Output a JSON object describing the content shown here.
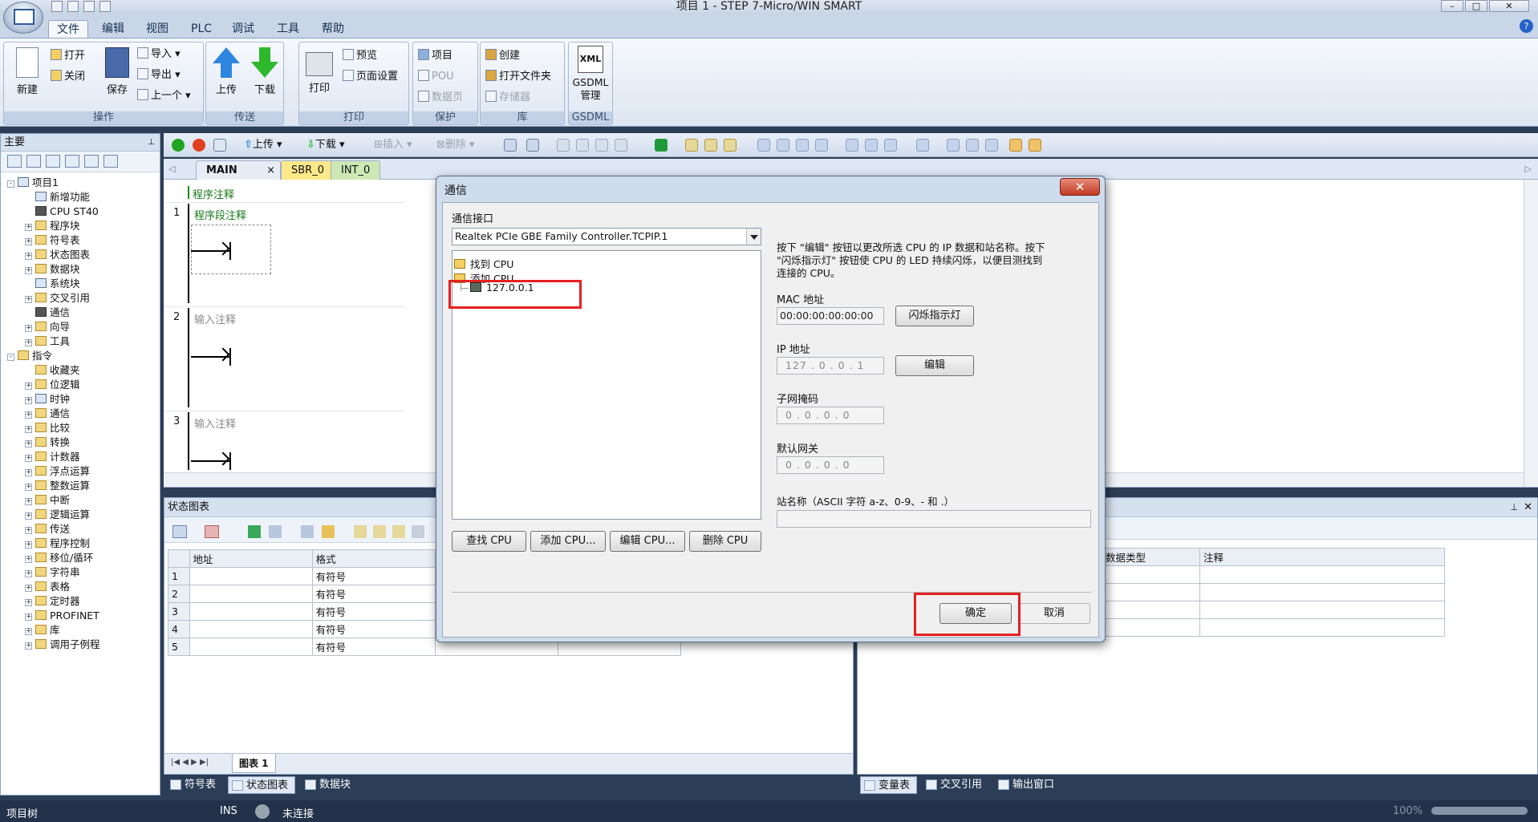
{
  "window": {
    "title": "项目 1 - STEP 7-Micro/WIN SMART"
  },
  "ribbon": {
    "tabs": [
      "文件",
      "编辑",
      "视图",
      "PLC",
      "调试",
      "工具",
      "帮助"
    ],
    "active_tab": "文件",
    "groups": {
      "operate": {
        "label": "操作",
        "new": "新建",
        "open": "打开",
        "close": "关闭",
        "save": "保存",
        "import": "导入",
        "export": "导出",
        "previous": "上一个"
      },
      "transfer": {
        "label": "传送",
        "upload": "上传",
        "download": "下载"
      },
      "print": {
        "label": "打印",
        "print": "打印",
        "preview": "预览",
        "page_setup": "页面设置"
      },
      "protect": {
        "label": "保护",
        "project": "项目",
        "pou": "POU",
        "data_page": "数据页"
      },
      "library": {
        "label": "库",
        "create": "创建",
        "open_folder": "打开文件夹",
        "memory": "存储器"
      },
      "gsdml": {
        "label": "GSDML",
        "xml": "XML",
        "manage_line1": "GSDML",
        "manage_line2": "管理"
      }
    },
    "help_icon": "?"
  },
  "left_panel": {
    "title": "主要",
    "pin": "📌",
    "tree": [
      {
        "label": "项目1",
        "level": 0,
        "expander": "-",
        "icon": "blue"
      },
      {
        "label": "新增功能",
        "level": 1,
        "expander": "",
        "icon": "blue"
      },
      {
        "label": "CPU ST40",
        "level": 1,
        "expander": "",
        "icon": "dark"
      },
      {
        "label": "程序块",
        "level": 1,
        "expander": "+",
        "icon": "folder"
      },
      {
        "label": "符号表",
        "level": 1,
        "expander": "+",
        "icon": "folder"
      },
      {
        "label": "状态图表",
        "level": 1,
        "expander": "+",
        "icon": "folder"
      },
      {
        "label": "数据块",
        "level": 1,
        "expander": "+",
        "icon": "folder"
      },
      {
        "label": "系统块",
        "level": 1,
        "expander": "",
        "icon": "blue"
      },
      {
        "label": "交叉引用",
        "level": 1,
        "expander": "+",
        "icon": "folder"
      },
      {
        "label": "通信",
        "level": 1,
        "expander": "",
        "icon": "dark"
      },
      {
        "label": "向导",
        "level": 1,
        "expander": "+",
        "icon": "folder"
      },
      {
        "label": "工具",
        "level": 1,
        "expander": "+",
        "icon": "folder"
      },
      {
        "label": "指令",
        "level": 0,
        "expander": "-",
        "icon": "folder"
      },
      {
        "label": "收藏夹",
        "level": 1,
        "expander": "",
        "icon": "folder"
      },
      {
        "label": "位逻辑",
        "level": 1,
        "expander": "+",
        "icon": "folder"
      },
      {
        "label": "时钟",
        "level": 1,
        "expander": "+",
        "icon": "blue"
      },
      {
        "label": "通信",
        "level": 1,
        "expander": "+",
        "icon": "folder"
      },
      {
        "label": "比较",
        "level": 1,
        "expander": "+",
        "icon": "folder"
      },
      {
        "label": "转换",
        "level": 1,
        "expander": "+",
        "icon": "folder"
      },
      {
        "label": "计数器",
        "level": 1,
        "expander": "+",
        "icon": "folder"
      },
      {
        "label": "浮点运算",
        "level": 1,
        "expander": "+",
        "icon": "folder"
      },
      {
        "label": "整数运算",
        "level": 1,
        "expander": "+",
        "icon": "folder"
      },
      {
        "label": "中断",
        "level": 1,
        "expander": "+",
        "icon": "folder"
      },
      {
        "label": "逻辑运算",
        "level": 1,
        "expander": "+",
        "icon": "folder"
      },
      {
        "label": "传送",
        "level": 1,
        "expander": "+",
        "icon": "folder"
      },
      {
        "label": "程序控制",
        "level": 1,
        "expander": "+",
        "icon": "folder"
      },
      {
        "label": "移位/循环",
        "level": 1,
        "expander": "+",
        "icon": "folder"
      },
      {
        "label": "字符串",
        "level": 1,
        "expander": "+",
        "icon": "folder"
      },
      {
        "label": "表格",
        "level": 1,
        "expander": "+",
        "icon": "folder"
      },
      {
        "label": "定时器",
        "level": 1,
        "expander": "+",
        "icon": "folder"
      },
      {
        "label": "PROFINET",
        "level": 1,
        "expander": "+",
        "icon": "folder"
      },
      {
        "label": "库",
        "level": 1,
        "expander": "+",
        "icon": "folder"
      },
      {
        "label": "调用子例程",
        "level": 1,
        "expander": "+",
        "icon": "folder"
      }
    ]
  },
  "toolbar": {
    "upload": "上传",
    "download": "下载",
    "insert": "插入",
    "delete": "删除"
  },
  "editor": {
    "tabs": [
      {
        "label": "MAIN",
        "close": "×",
        "color": "#e8edf5"
      },
      {
        "label": "SBR_0",
        "color": "#fde98a"
      },
      {
        "label": "INT_0",
        "color": "#cde8b4"
      }
    ],
    "program_comment": "程序注释",
    "networks": [
      {
        "num": "1",
        "comment": "程序段注释"
      },
      {
        "num": "2",
        "comment": "输入注释"
      },
      {
        "num": "3",
        "comment": "输入注释"
      }
    ]
  },
  "status_chart": {
    "title": "状态图表",
    "columns": [
      "",
      "地址",
      "格式"
    ],
    "rows": [
      {
        "n": "1",
        "addr": "",
        "fmt": "有符号"
      },
      {
        "n": "2",
        "addr": "",
        "fmt": "有符号"
      },
      {
        "n": "3",
        "addr": "",
        "fmt": "有符号"
      },
      {
        "n": "4",
        "addr": "",
        "fmt": "有符号"
      },
      {
        "n": "5",
        "addr": "",
        "fmt": "有符号"
      }
    ],
    "sheet_tab": "图表 1"
  },
  "right_panel": {
    "columns": [
      "数据类型",
      "注释"
    ],
    "pin": "📌",
    "close": "✕"
  },
  "bottom_tabs_left": [
    "符号表",
    "状态图表",
    "数据块"
  ],
  "bottom_tabs_right": [
    "变量表",
    "交叉引用",
    "输出窗口"
  ],
  "statusbar": {
    "tree": "项目树",
    "ins": "INS",
    "conn": "未连接",
    "zoom": "100%"
  },
  "dialog": {
    "title": "通信",
    "close": "✕",
    "interface_label": "通信接口",
    "interface_value": "Realtek PCIe GBE Family Controller.TCPIP.1",
    "tree": {
      "found": "找到 CPU",
      "added": "添加 CPU",
      "cpu": "127.0.0.1"
    },
    "description": [
      "按下 \"编辑\" 按钮以更改所选 CPU 的 IP 数据和站名称。按下",
      "\"闪烁指示灯\" 按钮使 CPU 的 LED 持续闪烁，以便目测找到",
      "连接的 CPU。"
    ],
    "mac_label": "MAC 地址",
    "mac_value": "00:00:00:00:00:00",
    "blink_btn": "闪烁指示灯",
    "ip_label": "IP 地址",
    "ip_value": "127 .  0  .  0  .  1",
    "edit_btn": "编辑",
    "subnet_label": "子网掩码",
    "subnet_value": "0  .  0  .  0  .  0",
    "gateway_label": "默认网关",
    "gateway_value": "0  .  0  .  0  .  0",
    "station_label": "站名称（ASCII 字符 a-z、0-9、- 和 .）",
    "station_value": "",
    "buttons": {
      "find": "查找 CPU",
      "add": "添加 CPU...",
      "edit": "编辑 CPU...",
      "delete": "删除 CPU"
    },
    "ok": "确定",
    "cancel": "取消"
  }
}
